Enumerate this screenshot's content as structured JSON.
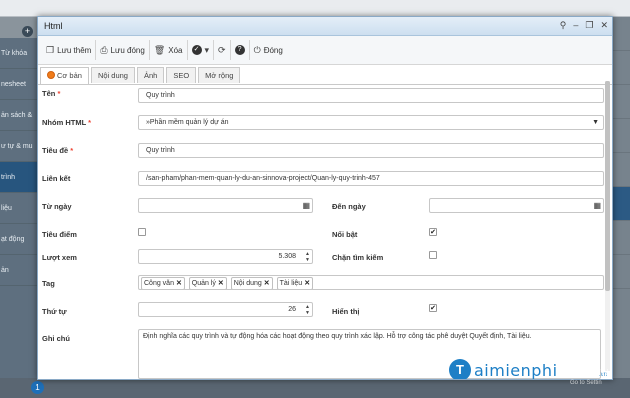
{
  "background": {
    "header": "Từ khóa",
    "nav_items": [
      "nesheet",
      "ản sách & ",
      "ư tự & mu",
      "trình",
      "liệu",
      "ạt động",
      "ản"
    ],
    "page": "1",
    "watermark_text": "Taimienphi.vn"
  },
  "dialog": {
    "title": "Html",
    "title_icons": [
      "pin-icon",
      "minimize-icon",
      "restore-icon",
      "close-icon"
    ],
    "toolbar": {
      "save_label": "Lưu thêm",
      "save_close_label": "Lưu đóng",
      "delete_label": "Xóa",
      "close_label": "Đóng"
    },
    "tabs": [
      "Cơ bản",
      "Nội dung",
      "Ảnh",
      "SEO",
      "Mở rộng"
    ],
    "form": {
      "ten_label": "Tên",
      "ten_value": "Quy trình",
      "nhom_label": "Nhóm HTML",
      "nhom_value": "»Phần mềm quản lý dự án",
      "tieude_label": "Tiêu đề",
      "tieude_value": "Quy trình",
      "lienket_label": "Liên kết",
      "lienket_value": "/san-pham/phan-mem-quan-ly-du-an-sinnova-project/Quan-ly-quy-trinh-457",
      "tungay_label": "Từ ngày",
      "tungay_value": "",
      "denngay_label": "Đến ngày",
      "denngay_value": "",
      "tieudiem_label": "Tiêu điểm",
      "tieudiem_checked": false,
      "noibat_label": "Nổi bật",
      "noibat_checked": true,
      "luotxem_label": "Lượt xem",
      "luotxem_value": "5.308",
      "chantimkiem_label": "Chặn tìm kiếm",
      "chantimkiem_checked": false,
      "tag_label": "Tag",
      "tags": [
        "Công văn",
        "Quản lý",
        "Nội dung",
        "Tài liệu"
      ],
      "thutu_label": "Thứ tự",
      "thutu_value": "26",
      "hienthi_label": "Hiển thị",
      "hienthi_checked": true,
      "ghichu_label": "Ghi chú",
      "ghichu_value": "Định nghĩa các quy trình và tự động hóa các hoạt động theo quy trình xác lập. Hỗ trợ công tác phê duyệt Quyết định, Tài liệu."
    }
  },
  "branding": {
    "logo_letter": "T",
    "name": "aimienphi",
    "suffix": ".vn"
  },
  "activate": {
    "line1": "Activate W",
    "line2": "Go to Settin"
  },
  "colors": {
    "accent": "#1d7fc6",
    "active_tab_dot": "#f07c1a",
    "required": "#ee4433"
  }
}
